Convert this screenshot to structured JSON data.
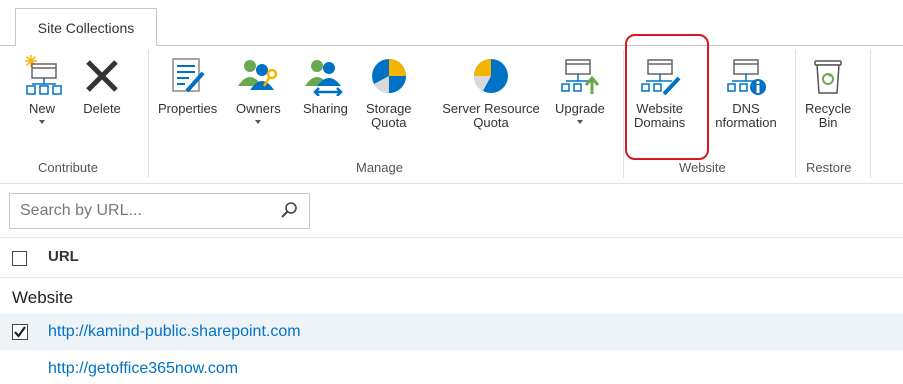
{
  "tab": {
    "label": "Site Collections"
  },
  "ribbon": {
    "buttons": [
      {
        "id": "new",
        "label": "New"
      },
      {
        "id": "delete",
        "label": "Delete"
      },
      {
        "id": "properties",
        "label": "Properties"
      },
      {
        "id": "owners",
        "label": "Owners"
      },
      {
        "id": "sharing",
        "label": "Sharing"
      },
      {
        "id": "storage_quota",
        "label1": "Storage",
        "label2": "Quota"
      },
      {
        "id": "server_resource_quota",
        "label1": "Server Resource",
        "label2": "Quota"
      },
      {
        "id": "upgrade",
        "label": "Upgrade"
      },
      {
        "id": "website_domains",
        "label1": "Website",
        "label2": "Domains"
      },
      {
        "id": "dns_information",
        "label1": "DNS",
        "label2": "nformation"
      },
      {
        "id": "recycle_bin",
        "label1": "Recycle",
        "label2": "Bin"
      }
    ],
    "groups": {
      "contribute": "Contribute",
      "manage": "Manage",
      "website": "Website",
      "restore": "Restore"
    }
  },
  "search": {
    "placeholder": "Search by URL..."
  },
  "list": {
    "column_header": "URL",
    "group_label": "Website",
    "rows": [
      {
        "url": "http://kamind-public.sharepoint.com",
        "checked": true
      },
      {
        "url": "http://getoffice365now.com",
        "checked": false
      }
    ]
  },
  "colors": {
    "accent": "#0072c6",
    "highlight": "#d7191f",
    "selected_row": "#edf3f7"
  }
}
